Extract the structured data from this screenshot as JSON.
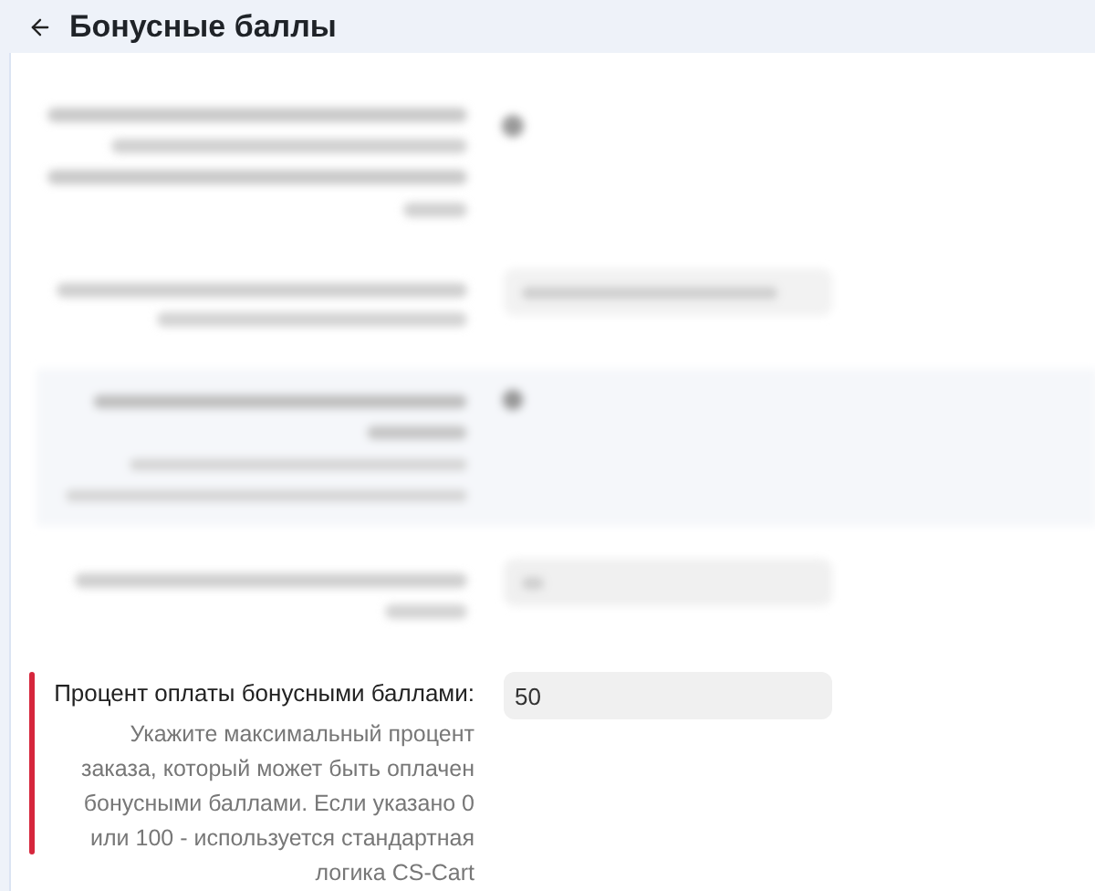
{
  "header": {
    "title": "Бонусные баллы"
  },
  "setting": {
    "label": "Процент оплаты бонусными баллами:",
    "help": "Укажите максимальный процент заказа, который может быть оплачен бонусными баллами. Если указано 0 или 100 - используется стандартная логика CS-Cart",
    "value": "50",
    "highlighted": true
  }
}
